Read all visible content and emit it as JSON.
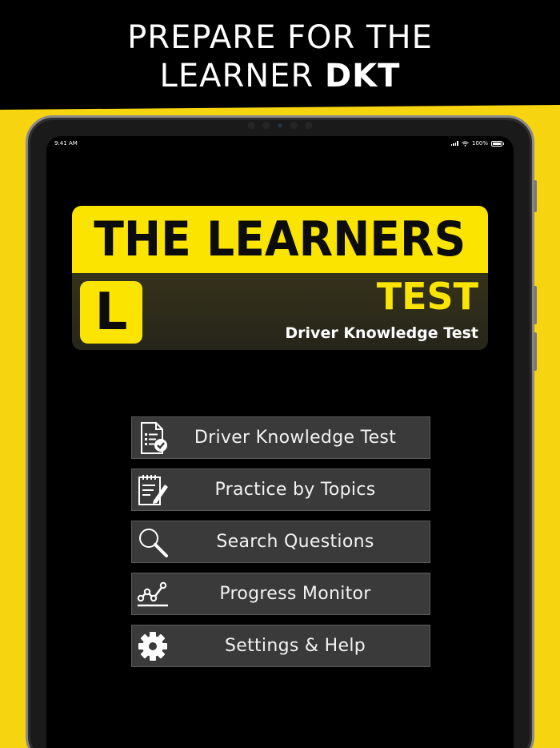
{
  "headline": {
    "line1": "PREPARE FOR THE",
    "line2_prefix": "LEARNER ",
    "line2_bold": "DKT"
  },
  "statusbar": {
    "time": "9:41 AM",
    "battery": "100%"
  },
  "logo": {
    "title": "THE LEARNERS",
    "plate_letter": "L",
    "subtitle": "TEST",
    "tagline": "Driver Knowledge Test"
  },
  "menu": {
    "items": [
      {
        "label": "Driver Knowledge Test",
        "icon": "checklist-icon"
      },
      {
        "label": "Practice by Topics",
        "icon": "clipboard-pencil-icon"
      },
      {
        "label": "Search Questions",
        "icon": "magnifier-icon"
      },
      {
        "label": "Progress Monitor",
        "icon": "line-graph-icon"
      },
      {
        "label": "Settings & Help",
        "icon": "gear-icon"
      }
    ]
  },
  "colors": {
    "brand_yellow": "#fbe500",
    "background_yellow": "#f7d410",
    "button_bg": "#3a3a3a"
  }
}
